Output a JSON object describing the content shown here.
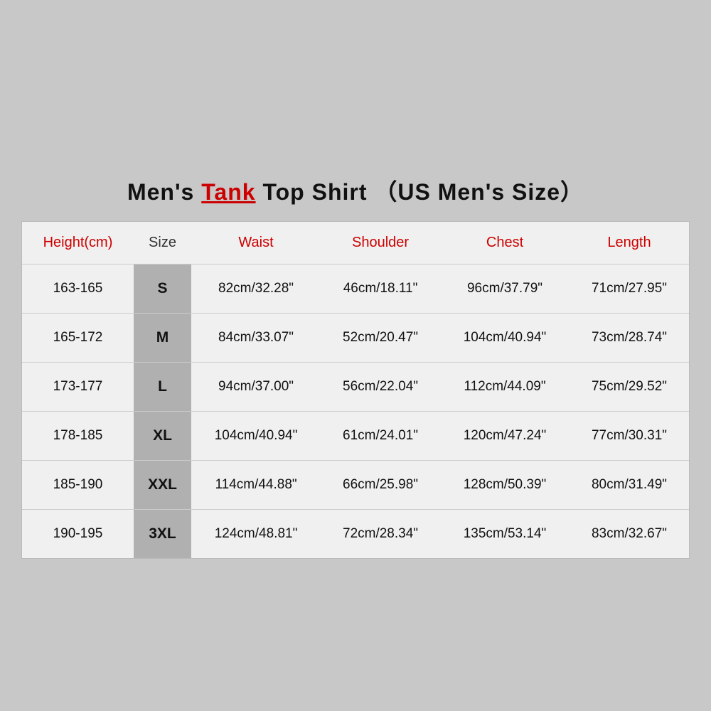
{
  "title": {
    "prefix": "Men's ",
    "highlight": "Tank",
    "suffix": " Top Shirt （US  Men's  Size）"
  },
  "table": {
    "headers": [
      "Height(cm)",
      "Size",
      "Waist",
      "Shoulder",
      "Chest",
      "Length"
    ],
    "rows": [
      {
        "height": "163-165",
        "size": "S",
        "waist": "82cm/32.28\"",
        "shoulder": "46cm/18.11\"",
        "chest": "96cm/37.79\"",
        "length": "71cm/27.95\""
      },
      {
        "height": "165-172",
        "size": "M",
        "waist": "84cm/33.07\"",
        "shoulder": "52cm/20.47\"",
        "chest": "104cm/40.94\"",
        "length": "73cm/28.74\""
      },
      {
        "height": "173-177",
        "size": "L",
        "waist": "94cm/37.00\"",
        "shoulder": "56cm/22.04\"",
        "chest": "112cm/44.09\"",
        "length": "75cm/29.52\""
      },
      {
        "height": "178-185",
        "size": "XL",
        "waist": "104cm/40.94\"",
        "shoulder": "61cm/24.01\"",
        "chest": "120cm/47.24\"",
        "length": "77cm/30.31\""
      },
      {
        "height": "185-190",
        "size": "XXL",
        "waist": "114cm/44.88\"",
        "shoulder": "66cm/25.98\"",
        "chest": "128cm/50.39\"",
        "length": "80cm/31.49\""
      },
      {
        "height": "190-195",
        "size": "3XL",
        "waist": "124cm/48.81\"",
        "shoulder": "72cm/28.34\"",
        "chest": "135cm/53.14\"",
        "length": "83cm/32.67\""
      }
    ]
  }
}
